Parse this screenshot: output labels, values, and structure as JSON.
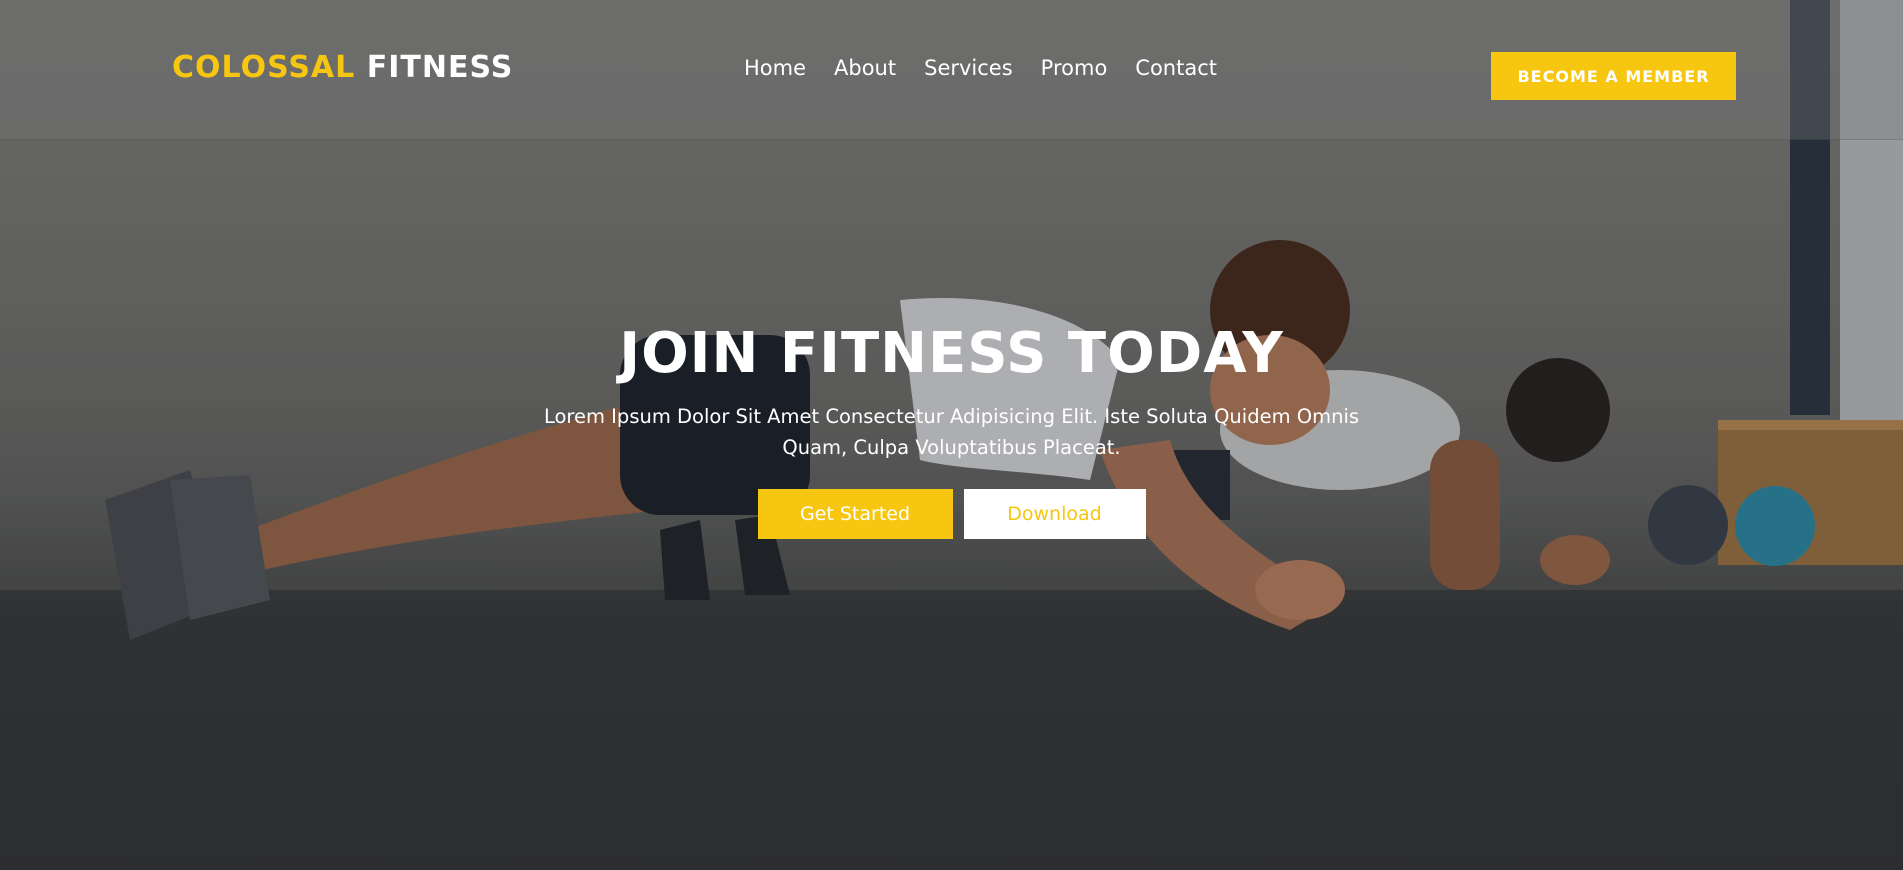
{
  "brand": {
    "accent": "COLOSSAL",
    "main": "FITNESS"
  },
  "nav": {
    "items": [
      {
        "label": "Home"
      },
      {
        "label": "About"
      },
      {
        "label": "Services"
      },
      {
        "label": "Promo"
      },
      {
        "label": "Contact"
      }
    ],
    "cta_label": "BECOME A MEMBER"
  },
  "hero": {
    "title": "JOIN FITNESS TODAY",
    "text": "Lorem Ipsum Dolor Sit Amet Consectetur Adipisicing Elit. Iste Soluta Quidem Omnis Quam, Culpa Voluptatibus Placeat.",
    "primary_label": "Get Started",
    "secondary_label": "Download",
    "background": "photo of two people doing plank exercise on a gym floor"
  },
  "colors": {
    "accent": "#f7c611",
    "text": "#ffffff",
    "button_secondary_bg": "#ffffff"
  }
}
